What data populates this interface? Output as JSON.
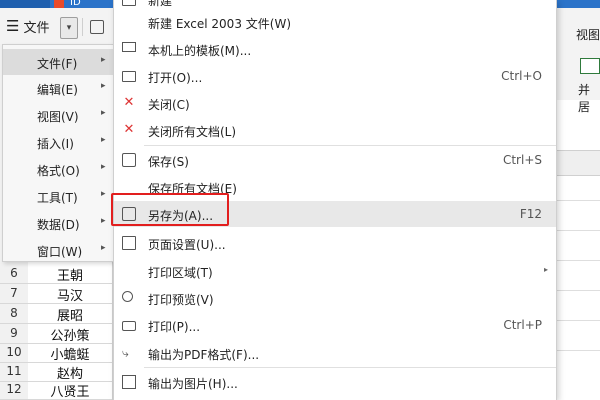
{
  "titlebar": {
    "text": "ID"
  },
  "toolbar": {
    "menu_label": "文件",
    "menu_icon": "hamburger-icon",
    "right_label": "视图"
  },
  "ribbon": {
    "merge_label": "并居"
  },
  "submenu": {
    "items": [
      {
        "label": "文件(F)"
      },
      {
        "label": "编辑(E)"
      },
      {
        "label": "视图(V)"
      },
      {
        "label": "插入(I)"
      },
      {
        "label": "格式(O)"
      },
      {
        "label": "工具(T)"
      },
      {
        "label": "数据(D)"
      },
      {
        "label": "窗口(W)"
      }
    ]
  },
  "filemenu": {
    "items": [
      {
        "label": "新建",
        "shortcut": ""
      },
      {
        "label": "新建 Excel 2003 文件(W)",
        "shortcut": ""
      },
      {
        "label": "本机上的模板(M)...",
        "shortcut": ""
      },
      {
        "label": "打开(O)...",
        "shortcut": "Ctrl+O"
      },
      {
        "label": "关闭(C)",
        "shortcut": ""
      },
      {
        "label": "关闭所有文档(L)",
        "shortcut": ""
      },
      {
        "label": "保存(S)",
        "shortcut": "Ctrl+S"
      },
      {
        "label": "保存所有文档(E)",
        "shortcut": ""
      },
      {
        "label": "另存为(A)...",
        "shortcut": "F12"
      },
      {
        "label": "页面设置(U)...",
        "shortcut": ""
      },
      {
        "label": "打印区域(T)",
        "shortcut": ""
      },
      {
        "label": "打印预览(V)",
        "shortcut": ""
      },
      {
        "label": "打印(P)...",
        "shortcut": "Ctrl+P"
      },
      {
        "label": "输出为PDF格式(F)...",
        "shortcut": ""
      },
      {
        "label": "输出为图片(H)...",
        "shortcut": ""
      }
    ]
  },
  "sheet": {
    "rows": [
      {
        "num": "6",
        "name": "王朝"
      },
      {
        "num": "7",
        "name": "马汉"
      },
      {
        "num": "8",
        "name": "展昭"
      },
      {
        "num": "9",
        "name": "公孙策"
      },
      {
        "num": "10",
        "name": "小蟾蜓"
      },
      {
        "num": "11",
        "name": "赵构"
      },
      {
        "num": "12",
        "name": "八贤王"
      }
    ]
  },
  "colors": {
    "highlight_box": "#e21e1e",
    "title_blue": "#2b73c9"
  }
}
